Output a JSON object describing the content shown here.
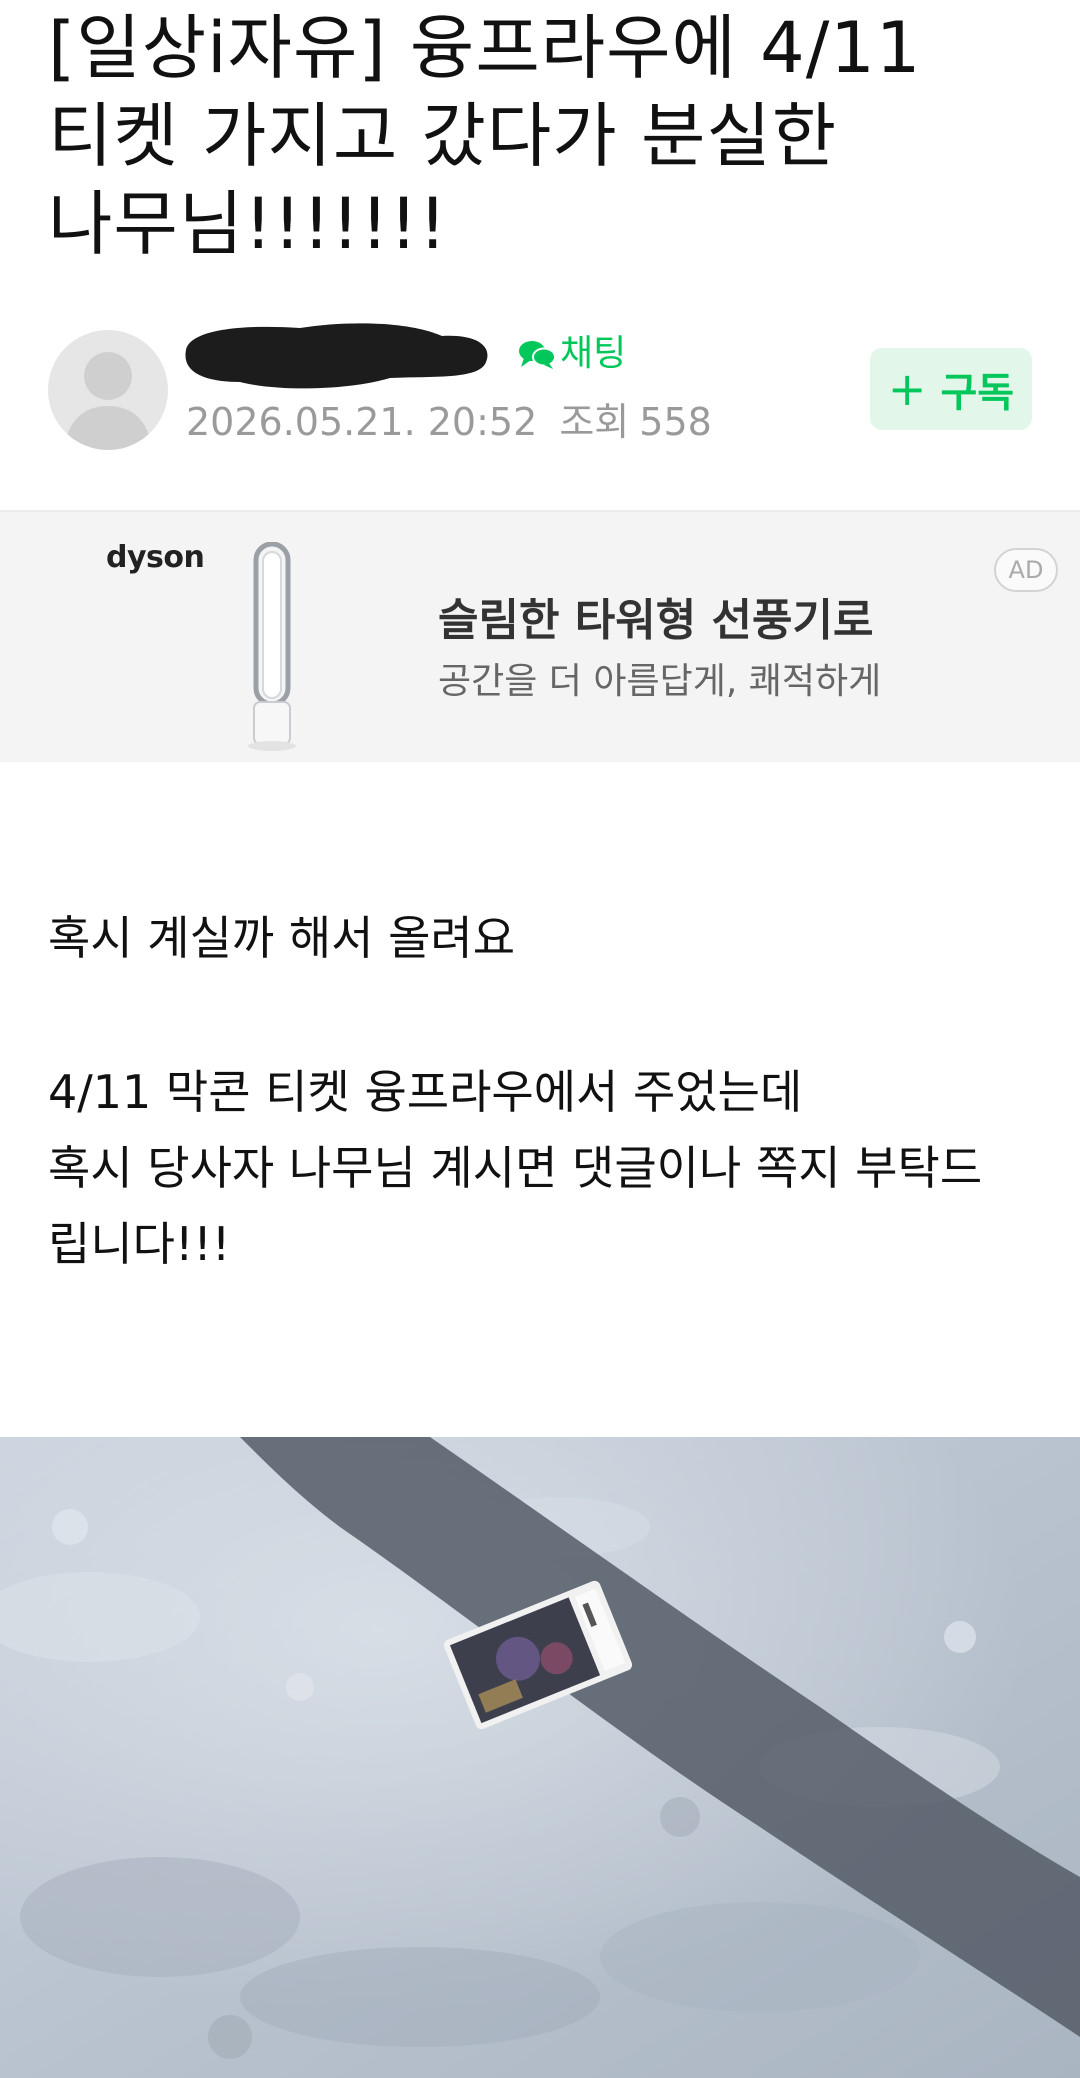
{
  "post": {
    "title": "[일상i자유] 융프라우에 4/11 티켓 가지고 갔다가 분실한 나무님!!!!!!!"
  },
  "author": {
    "chat_label": "채팅",
    "date": "2026.05.21. 20:52",
    "views_label": "조회",
    "views": "558",
    "subscribe_label": "구독"
  },
  "ad": {
    "brand": "dyson",
    "headline": "슬림한 타워형 선풍기로",
    "subline": "공간을 더 아름답게, 쾌적하게",
    "badge": "AD"
  },
  "body": {
    "line1": "혹시 계실까 해서 올려요",
    "line2": "4/11 막콘 티켓 융프라우에서 주었는데",
    "line3": "혹시 당사자 나무님 계시면 댓글이나 쪽지 부탁드",
    "line4": "립니다!!!"
  },
  "colors": {
    "accent": "#03c75a",
    "subscribe_bg": "#e2f7ea",
    "meta_text": "#9a9a9a",
    "ad_bg": "#f4f4f5"
  },
  "icons": {
    "chat": "speech-bubbles-icon",
    "avatar": "default-profile-icon",
    "subscribe": "plus-icon"
  }
}
